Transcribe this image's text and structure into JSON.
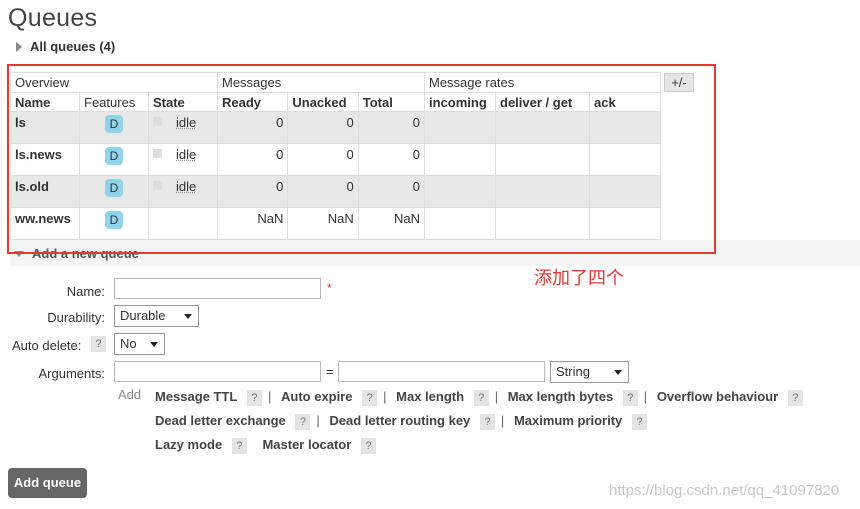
{
  "page": {
    "title": "Queues"
  },
  "all_queues": {
    "label": "All queues (4)"
  },
  "table": {
    "groups": [
      "Overview",
      "Messages",
      "Message rates"
    ],
    "columns": [
      "Name",
      "Features",
      "State",
      "Ready",
      "Unacked",
      "Total",
      "incoming",
      "deliver / get",
      "ack"
    ],
    "plus_minus": "+/-",
    "rows": [
      {
        "name": "ls",
        "feature": "D",
        "state": "idle",
        "ready": "0",
        "unacked": "0",
        "total": "0"
      },
      {
        "name": "ls.news",
        "feature": "D",
        "state": "idle",
        "ready": "0",
        "unacked": "0",
        "total": "0"
      },
      {
        "name": "ls.old",
        "feature": "D",
        "state": "idle",
        "ready": "0",
        "unacked": "0",
        "total": "0"
      },
      {
        "name": "ww.news",
        "feature": "D",
        "state": "",
        "ready": "NaN",
        "unacked": "NaN",
        "total": "NaN"
      }
    ]
  },
  "annotation": "添加了四个",
  "add_queue": {
    "section_label": "Add a new queue",
    "name_label": "Name:",
    "required_mark": "*",
    "durability_label": "Durability:",
    "durability_value": "Durable",
    "auto_delete_label": "Auto delete:",
    "auto_delete_value": "No",
    "arguments_label": "Arguments:",
    "equals": "=",
    "arg_type_value": "String",
    "add_word": "Add",
    "help": "?",
    "options_row1": [
      "Message TTL",
      "Auto expire",
      "Max length",
      "Max length bytes",
      "Overflow behaviour"
    ],
    "options_row2": [
      "Dead letter exchange",
      "Dead letter routing key",
      "Maximum priority"
    ],
    "options_row3": [
      "Lazy mode",
      "Master locator"
    ],
    "separator": "|",
    "button": "Add queue"
  },
  "watermark": "https://blog.csdn.net/qq_41097820",
  "colors": {
    "highlight": "#e53935",
    "badge": "#8fd4ea",
    "button": "#666666"
  }
}
